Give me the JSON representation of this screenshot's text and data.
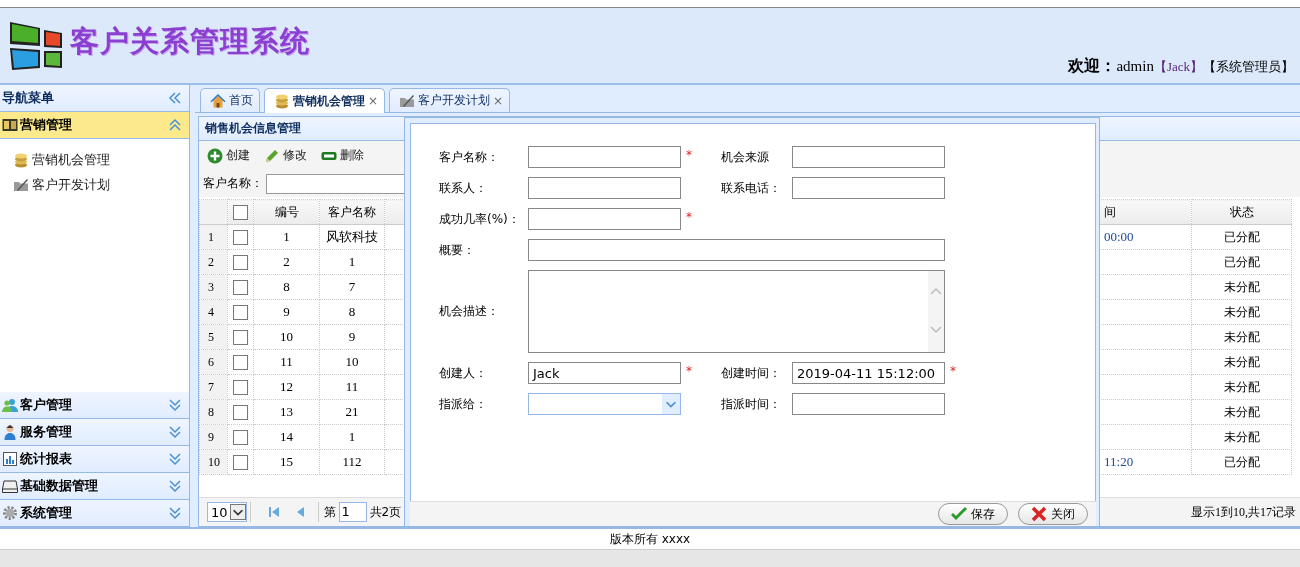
{
  "header": {
    "title": "客户关系管理系统",
    "welcome_label": "欢迎：",
    "user": "admin",
    "nickname": "【Jack】",
    "role": "【系统管理员】"
  },
  "sidebar": {
    "title": "导航菜单",
    "groups": [
      {
        "label": "营销管理",
        "kind": "ledger",
        "expanded": true,
        "items": [
          {
            "label": "营销机会管理",
            "kind": "coins"
          },
          {
            "label": "客户开发计划",
            "kind": "folder"
          }
        ]
      },
      {
        "label": "客户管理",
        "kind": "users",
        "expanded": false
      },
      {
        "label": "服务管理",
        "kind": "person",
        "expanded": false
      },
      {
        "label": "统计报表",
        "kind": "chart",
        "expanded": false
      },
      {
        "label": "基础数据管理",
        "kind": "drive",
        "expanded": false
      },
      {
        "label": "系统管理",
        "kind": "gear",
        "expanded": false
      }
    ]
  },
  "tabs": [
    {
      "label": "首页",
      "kind": "home",
      "selected": false
    },
    {
      "label": "营销机会管理",
      "kind": "coins",
      "selected": true,
      "close": "×"
    },
    {
      "label": "客户开发计划",
      "kind": "folder",
      "selected": false,
      "close": "×"
    }
  ],
  "panel": {
    "title": "销售机会信息管理",
    "toolbar": [
      {
        "label": "创建",
        "kind": "add"
      },
      {
        "label": "修改",
        "kind": "edit"
      },
      {
        "label": "删除",
        "kind": "remove"
      }
    ],
    "search_label": "客户名称：",
    "table": {
      "header_checked": false,
      "columns": [
        "编号",
        "客户名称",
        "间",
        "状态"
      ],
      "rows": [
        {
          "num": "1",
          "checked": false,
          "id": "1",
          "name": "风软科技",
          "time": "00:00",
          "status": "已分配"
        },
        {
          "num": "2",
          "checked": false,
          "id": "2",
          "name": "1",
          "status": "已分配"
        },
        {
          "num": "3",
          "checked": false,
          "id": "8",
          "name": "7",
          "status": "未分配"
        },
        {
          "num": "4",
          "checked": false,
          "id": "9",
          "name": "8",
          "status": "未分配"
        },
        {
          "num": "5",
          "checked": false,
          "id": "10",
          "name": "9",
          "status": "未分配"
        },
        {
          "num": "6",
          "checked": false,
          "id": "11",
          "name": "10",
          "status": "未分配"
        },
        {
          "num": "7",
          "checked": false,
          "id": "12",
          "name": "11",
          "status": "未分配"
        },
        {
          "num": "8",
          "checked": false,
          "id": "13",
          "name": "21",
          "status": "未分配"
        },
        {
          "num": "9",
          "checked": false,
          "id": "14",
          "name": "1",
          "status": "未分配"
        },
        {
          "num": "10",
          "checked": false,
          "id": "15",
          "name": "112",
          "time": "11:20",
          "status": "已分配"
        }
      ]
    },
    "pager": {
      "page_size": "10",
      "page_prefix": "第",
      "page": "1",
      "page_suffix": "共2页",
      "summary": "显示1到10,共17记录"
    }
  },
  "dialog": {
    "rows": [
      [
        {
          "label": "客户名称：",
          "kind": "text",
          "required_mark": "*"
        },
        {
          "label": "机会来源",
          "kind": "text"
        }
      ],
      [
        {
          "label": "联系人：",
          "kind": "text"
        },
        {
          "label": "联系电话：",
          "kind": "text"
        }
      ],
      [
        {
          "label": "成功几率(%)：",
          "kind": "text",
          "required_mark": "*"
        }
      ],
      [
        {
          "label": "概要：",
          "kind": "wide"
        }
      ],
      [
        {
          "label": "机会描述：",
          "kind": "textarea"
        }
      ],
      [
        {
          "label": "创建人：",
          "kind": "text",
          "value": "Jack",
          "required_mark": "*"
        },
        {
          "label": "创建时间：",
          "kind": "text",
          "value": "2019-04-11 15:12:00",
          "required_mark": "*"
        }
      ],
      [
        {
          "label": "指派给：",
          "kind": "select"
        },
        {
          "label": "指派时间：",
          "kind": "text"
        }
      ]
    ],
    "buttons": [
      {
        "label": "保存",
        "kind": "save"
      },
      {
        "label": "关闭",
        "kind": "close"
      }
    ]
  },
  "footer": "版本所有 xxxx"
}
